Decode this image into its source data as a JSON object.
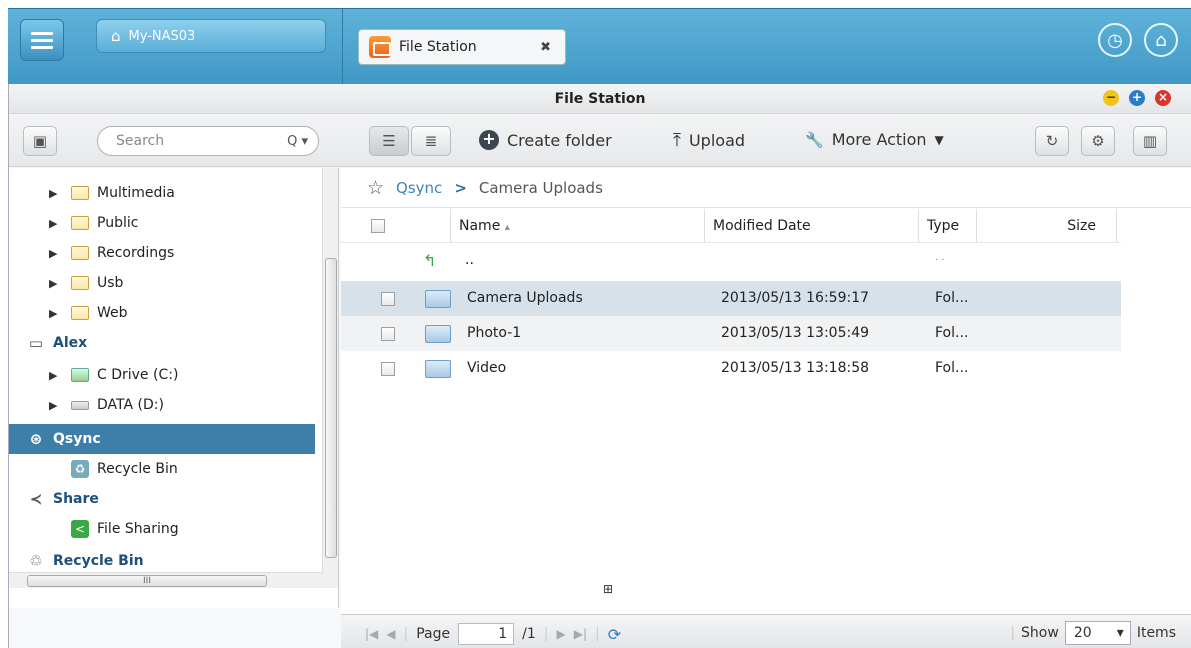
{
  "taskbar": {
    "nas_name": "My-NAS03",
    "open_app_tab": "File Station",
    "close_glyph": "✖",
    "clock_glyph": "◷",
    "device_glyph": "⌂"
  },
  "window": {
    "title": "File Station",
    "controls": {
      "minimize": "−",
      "maximize": "+",
      "close": "×"
    }
  },
  "toolbar": {
    "search_placeholder": "Search",
    "search_glyph": "Q ▾",
    "create_folder": "Create folder",
    "upload": "Upload",
    "more_action": "More Action",
    "upload_glyph": "⤒",
    "more_action_glyph": "🔧",
    "more_action_caret": "▼",
    "refresh_glyph": "↻",
    "settings_glyph": "⚙",
    "panel_glyph": "▥",
    "create_glyph": "+",
    "list_glyph": "☰",
    "detail_glyph": "≣",
    "sidebar_glyph": "▣"
  },
  "tree": {
    "folders": [
      "Multimedia",
      "Public",
      "Recordings",
      "Usb",
      "Web"
    ],
    "alex": "Alex",
    "drives": [
      "C Drive (C:)",
      "DATA (D:)"
    ],
    "qsync": "Qsync",
    "qsync_recycle": "Recycle Bin",
    "share": "Share",
    "file_sharing": "File Sharing",
    "recycle_bin": "Recycle Bin",
    "hscroll_grip": "III"
  },
  "breadcrumb": {
    "root": "Qsync",
    "separator": ">",
    "current": "Camera Uploads",
    "star": "☆"
  },
  "table": {
    "columns": {
      "name": "Name",
      "sort": "▴",
      "modified": "Modified Date",
      "type": "Type",
      "size": "Size"
    },
    "up_label": "..",
    "up_type": "· ·",
    "rows": [
      {
        "name": "Camera Uploads",
        "modified": "2013/05/13 16:59:17",
        "type": "Fol..."
      },
      {
        "name": "Photo-1",
        "modified": "2013/05/13 13:05:49",
        "type": "Fol..."
      },
      {
        "name": "Video",
        "modified": "2013/05/13 13:18:58",
        "type": "Fol..."
      }
    ],
    "center_mark": "⊞"
  },
  "footer": {
    "page_label": "Page",
    "page_value": "1",
    "page_total": "/1",
    "show_label": "Show",
    "show_value": "20",
    "items_label": "Items",
    "nav_first": "|◀",
    "nav_prev": "◀",
    "nav_next": "▶",
    "nav_last": "▶|",
    "refresh_glyph": "⟳",
    "dropdown_glyph": "▾"
  },
  "colors": {
    "taskbar": "#4aa3d0",
    "selected_tree": "#3d7fa8",
    "selected_row": "#d7e1e9",
    "link": "#3a86b8"
  }
}
